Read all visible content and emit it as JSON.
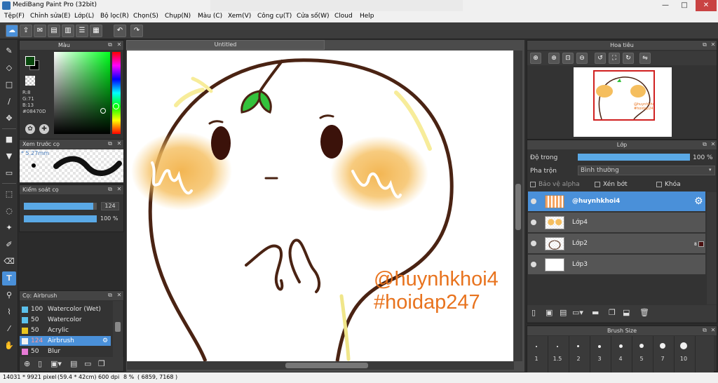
{
  "window": {
    "title": "MediBang Paint Pro (32bit)",
    "buttons": [
      "—",
      "□",
      "✕"
    ]
  },
  "menu": [
    "Tệp(F)",
    "Chỉnh sửa(E)",
    "Lớp(L)",
    "Bộ lọc(R)",
    "Chọn(S)",
    "Chụp(N)",
    "Màu (C)",
    "Xem(V)",
    "Công cụ(T)",
    "Cửa số(W)",
    "Cloud",
    "Help"
  ],
  "color_panel": {
    "title": "Màu",
    "r": "R:8",
    "g": "G:71",
    "b": "B:13",
    "hex": "#08470D",
    "fg_color": "#08470D",
    "bg_color": "#000000"
  },
  "brush_preview": {
    "title": "Xem trước cọ",
    "size": "* 5.27mm"
  },
  "brush_control": {
    "title": "Kiểm soát cọ",
    "size_value": "124",
    "opacity_value": "100 %",
    "size_fraction": 0.95,
    "opacity_fraction": 1.0
  },
  "brush_list": {
    "title": "Cọ: Airbrush",
    "items": [
      {
        "size": "100",
        "name": "Watercolor (Wet)",
        "color": "#5bc0eb"
      },
      {
        "size": "50",
        "name": "Watercolor",
        "color": "#5bc0eb"
      },
      {
        "size": "50",
        "name": "Acrylic",
        "color": "#e8c51e"
      },
      {
        "size": "124",
        "name": "Airbrush",
        "color": "#f2f2f2"
      },
      {
        "size": "50",
        "name": "Blur",
        "color": "#e77bd6"
      }
    ]
  },
  "document": {
    "tab": "Untitled"
  },
  "artwork": {
    "text1": "@huynhkhoi4",
    "text2": "#hoidap247",
    "text_color": "#e8731e"
  },
  "navigator": {
    "title": "Hoa tiêu"
  },
  "layer_panel": {
    "title": "Lớp",
    "opacity_label": "Độ trong",
    "opacity_value": "100 %",
    "opacity_fraction": 1.0,
    "blend_label": "Pha trộn",
    "blend_value": "Bình thường",
    "protect_alpha": "Bảo vệ alpha",
    "clipping": "Xén bớt",
    "lock": "Khóa",
    "layers": [
      {
        "name": "@huynhkhoi4",
        "selected": true
      },
      {
        "name": "Lớp4",
        "selected": false
      },
      {
        "name": "Lớp2",
        "selected": false,
        "badge": "8"
      },
      {
        "name": "Lớp3",
        "selected": false
      }
    ]
  },
  "brush_size_panel": {
    "title": "Brush Size",
    "sizes": [
      "1",
      "1.5",
      "2",
      "3",
      "4",
      "5",
      "7",
      "10"
    ]
  },
  "status": {
    "dimensions": "14031 * 9921 pixel",
    "physical": "(59.4 * 42cm)",
    "dpi": "600 dpi",
    "zoom": "8 %",
    "coords": "( 6859, 7168 )"
  }
}
